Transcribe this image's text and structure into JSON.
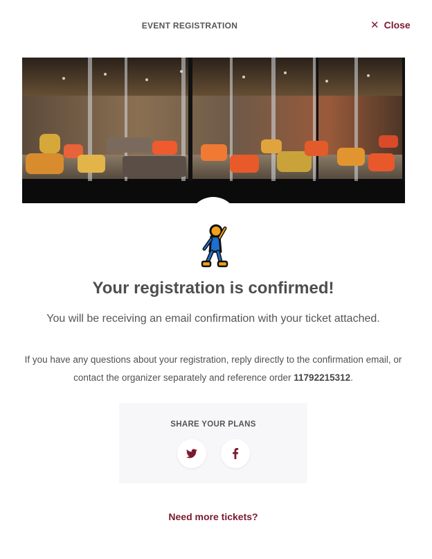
{
  "header": {
    "title": "EVENT REGISTRATION",
    "close_label": "Close",
    "close_icon": "close-icon"
  },
  "hero": {
    "image": "lounge-photo"
  },
  "confirmation": {
    "avatar_icon": "walking-person-icon",
    "title": "Your registration is confirmed!",
    "subtitle": "You will be receiving an email confirmation with your ticket attached.",
    "info_line1": "If you have any questions about your registration, reply directly to the confirmation email, or",
    "info_line2_prefix": "contact the organizer separately and reference order ",
    "order_number": "11792215312",
    "info_line2_suffix": "."
  },
  "share": {
    "title": "SHARE YOUR PLANS",
    "buttons": [
      {
        "icon": "twitter-icon"
      },
      {
        "icon": "facebook-icon"
      }
    ]
  },
  "footer": {
    "more_tickets_label": "Need more tickets?"
  },
  "colors": {
    "accent": "#7a1a2e",
    "text": "#4e4e4e",
    "share_bg": "#f7f7f9",
    "avatar_blue": "#1e6fd0",
    "avatar_orange": "#f2a11a"
  }
}
